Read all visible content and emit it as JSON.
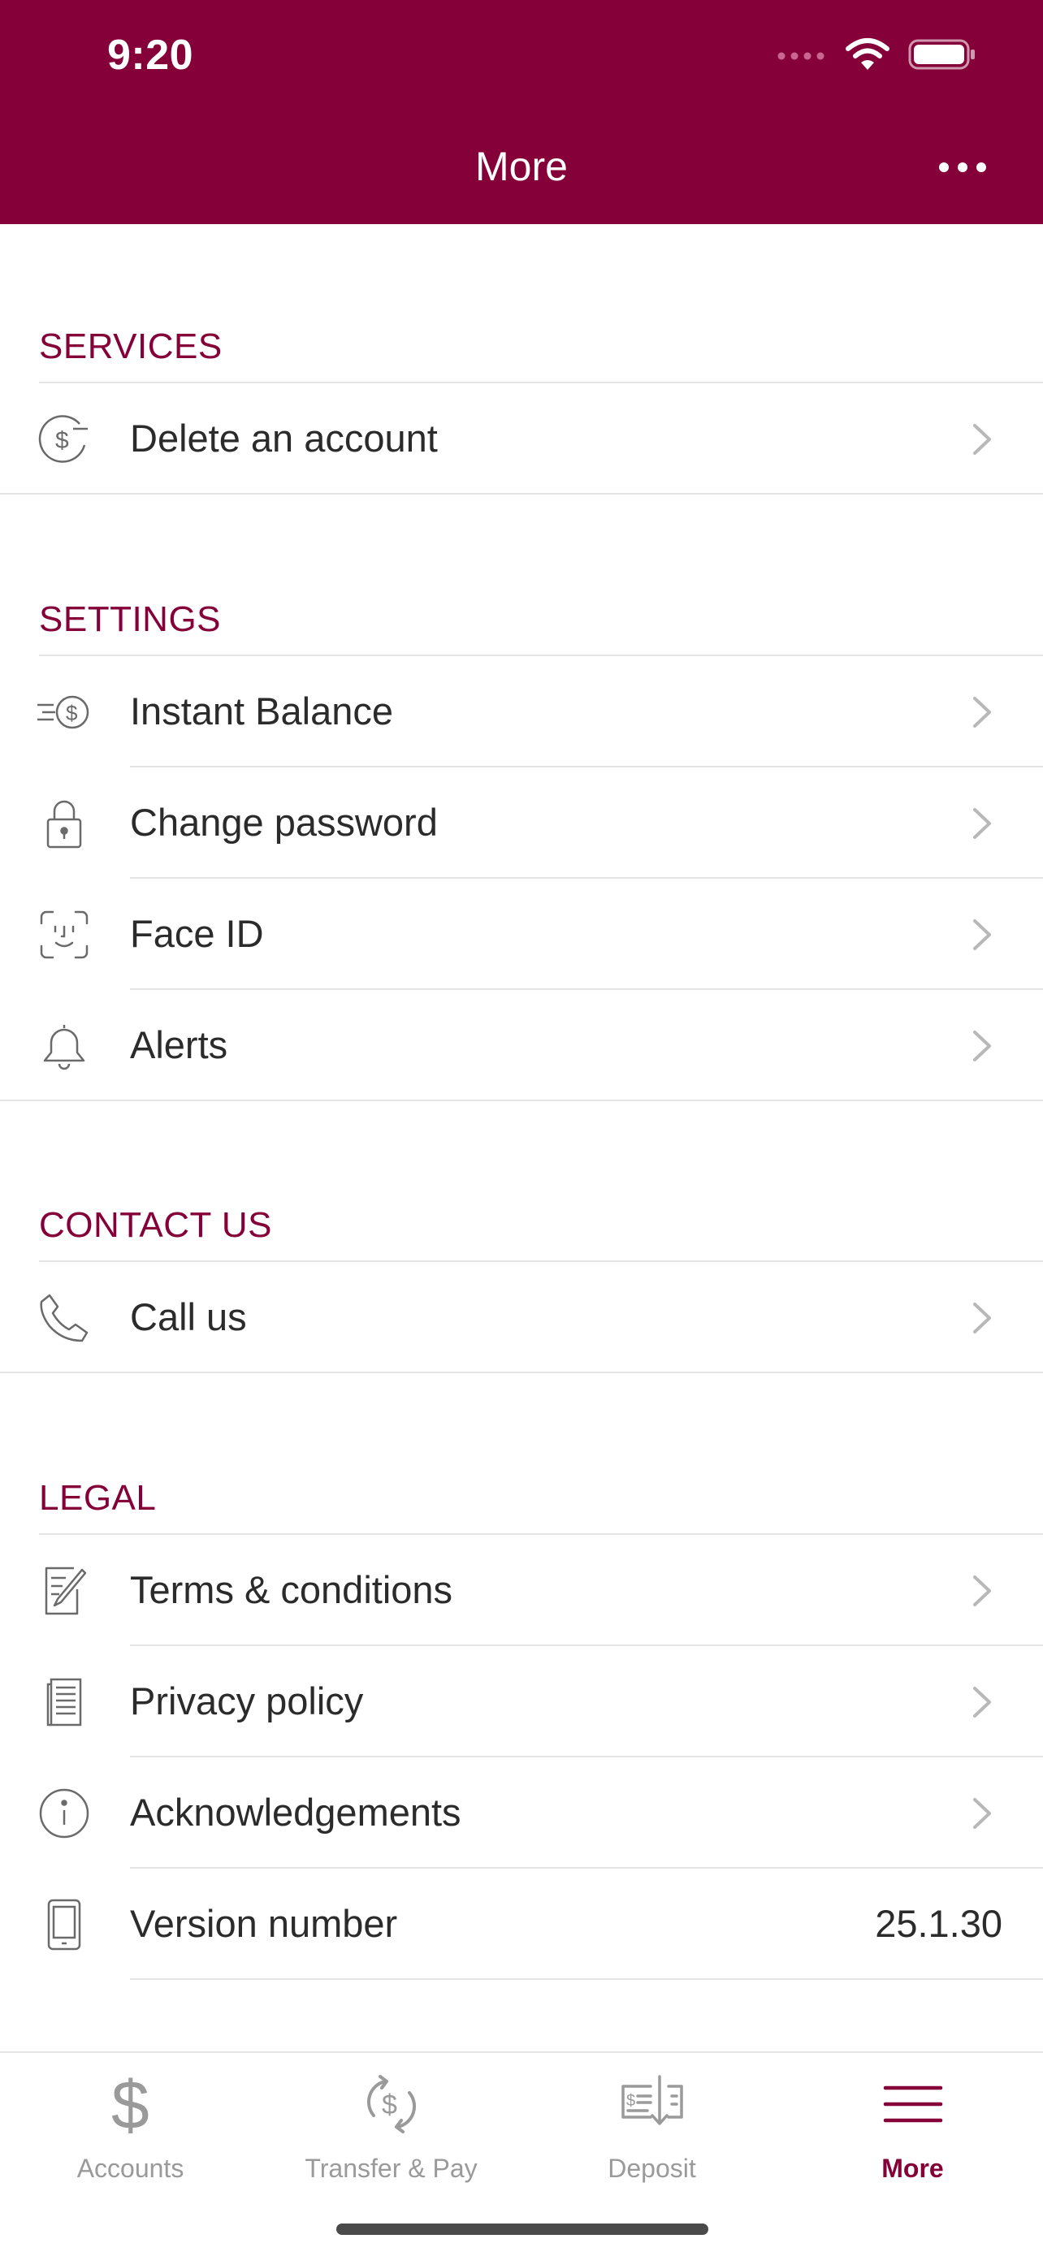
{
  "status_bar": {
    "time": "9:20"
  },
  "header": {
    "title": "More"
  },
  "sections": {
    "services": {
      "label": "SERVICES",
      "items": [
        {
          "label": "Delete an account",
          "icon": "dollar-minus-icon"
        }
      ]
    },
    "settings": {
      "label": "SETTINGS",
      "items": [
        {
          "label": "Instant Balance",
          "icon": "fast-dollar-icon"
        },
        {
          "label": "Change password",
          "icon": "lock-icon"
        },
        {
          "label": "Face ID",
          "icon": "face-id-icon"
        },
        {
          "label": "Alerts",
          "icon": "bell-icon"
        }
      ]
    },
    "contact": {
      "label": "CONTACT US",
      "items": [
        {
          "label": "Call us",
          "icon": "phone-icon"
        }
      ]
    },
    "legal": {
      "label": "LEGAL",
      "items": [
        {
          "label": "Terms & conditions",
          "icon": "document-pen-icon"
        },
        {
          "label": "Privacy policy",
          "icon": "document-lines-icon"
        },
        {
          "label": "Acknowledgements",
          "icon": "info-icon"
        },
        {
          "label": "Version number",
          "icon": "mobile-device-icon",
          "value": "25.1.30"
        }
      ]
    }
  },
  "tabbar": {
    "tabs": [
      {
        "label": "Accounts",
        "icon": "dollar-icon"
      },
      {
        "label": "Transfer & Pay",
        "icon": "transfer-dollar-icon"
      },
      {
        "label": "Deposit",
        "icon": "check-deposit-icon"
      },
      {
        "label": "More",
        "icon": "hamburger-icon"
      }
    ],
    "active": "More"
  },
  "colors": {
    "brand": "#850038",
    "text": "#2b2b2b",
    "inactive_tab": "#9a9a9a",
    "separator": "#e4e4e4"
  }
}
